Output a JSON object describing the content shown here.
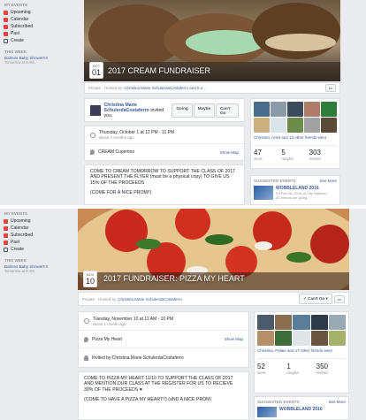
{
  "pane1": {
    "sidebar": {
      "heading": "MY EVENTS",
      "items": [
        {
          "label": "Upcoming",
          "color": "#e9453f"
        },
        {
          "label": "Calendar",
          "color": "#e9453f"
        },
        {
          "label": "Subscribed",
          "color": "#e9453f"
        },
        {
          "label": "Past",
          "color": "#e9453f"
        },
        {
          "label": "Create",
          "color": "#4b4f56"
        }
      ],
      "week_heading": "THIS WEEK",
      "week_event": "Balmes Baby Shower!!!!",
      "week_time": "Tomorrow at 8 AM"
    },
    "cover_title": "2017 CREAM FUNDRAISER",
    "date_month": "OCT",
    "date_day": "01",
    "privacy_prefix": "Private · Hosted by",
    "hosts": "Christina Marie SchulerdaCostaferro and 5 o...",
    "more": "•••",
    "inviter": "Christina Marie SchulerdaCostaferro",
    "invited_suffix": "invited you.",
    "rsvp": [
      "Going",
      "Maybe",
      "Can't Go"
    ],
    "when": "Thursday, October 1 at 12 PM - 11 PM",
    "when_sub": "about 2 months ago",
    "location": "CREAM Cupertino",
    "show_map": "Show Map",
    "desc1": "COME TO CREAM TOMORROW TO SUPPORT THE CLASS OF 2017 AND PRESENT THE FLYER (must be a physical copy) TO GIVE US 15% OF THE PROCEEDS",
    "desc2": "(COME FOR A NICE PROM!!)",
    "friends_text": "Christina, Ankit and 13 other friends went",
    "stats": [
      {
        "num": "47",
        "label": "went"
      },
      {
        "num": "5",
        "label": "maybe"
      },
      {
        "num": "303",
        "label": "invited"
      }
    ],
    "suggested_heading": "SUGGESTED EVENTS",
    "see_more": "See More",
    "sug_name": "WOBBLELAND 2016",
    "sug_time": "Fri Feb 26, 2016 at City Nationa...",
    "sug_extra": "22 friends are going..."
  },
  "pane2": {
    "sidebar": {
      "heading": "MY EVENTS",
      "items": [
        {
          "label": "Upcoming",
          "color": "#e9453f"
        },
        {
          "label": "Calendar",
          "color": "#e9453f"
        },
        {
          "label": "Subscribed",
          "color": "#e9453f"
        },
        {
          "label": "Past",
          "color": "#e9453f"
        },
        {
          "label": "Create",
          "color": "#4b4f56"
        }
      ],
      "week_heading": "THIS WEEK",
      "week_event": "Balmes Baby Shower!!!!",
      "week_time": "Tomorrow at 8 AM"
    },
    "cover_title": "2017 FUNDRAISER: PIZZA MY HEART",
    "date_month": "NOV",
    "date_day": "10",
    "privacy_prefix": "Private · Hosted by",
    "hosts": "Christina Marie SchulerdaCostaferro",
    "cant_go": "✓ Can't Go ▾",
    "more": "•••",
    "when": "Tuesday, November 10 at 11 AM - 10 PM",
    "when_sub": "about 1 month ago",
    "location": "Pizza My Heart",
    "show_map": "Show Map",
    "invited_by": "Invited by Christina Marie SchulerdaCostaferro",
    "desc1": "COME TO PIZZA MY HEART 11/10 TO SUPPORT THE CLASS OF 2017 AND MENTION OUR CLASS AT THE REGISTER FOR US TO RECIEVE 30% OF THE PROCEEDS ♥",
    "desc2": "(COME TO HAVE A PIZZA MY HEART!!) (aND A NICE PROM)",
    "friends_text": "Christina, Palaie and 17 other friends went",
    "stats": [
      {
        "num": "52",
        "label": "went"
      },
      {
        "num": "1",
        "label": "maybe"
      },
      {
        "num": "350",
        "label": "invited"
      }
    ],
    "suggested_heading": "SUGGESTED EVENTS",
    "see_more": "See More",
    "sug_name": "WOBBLELAND 2016"
  }
}
